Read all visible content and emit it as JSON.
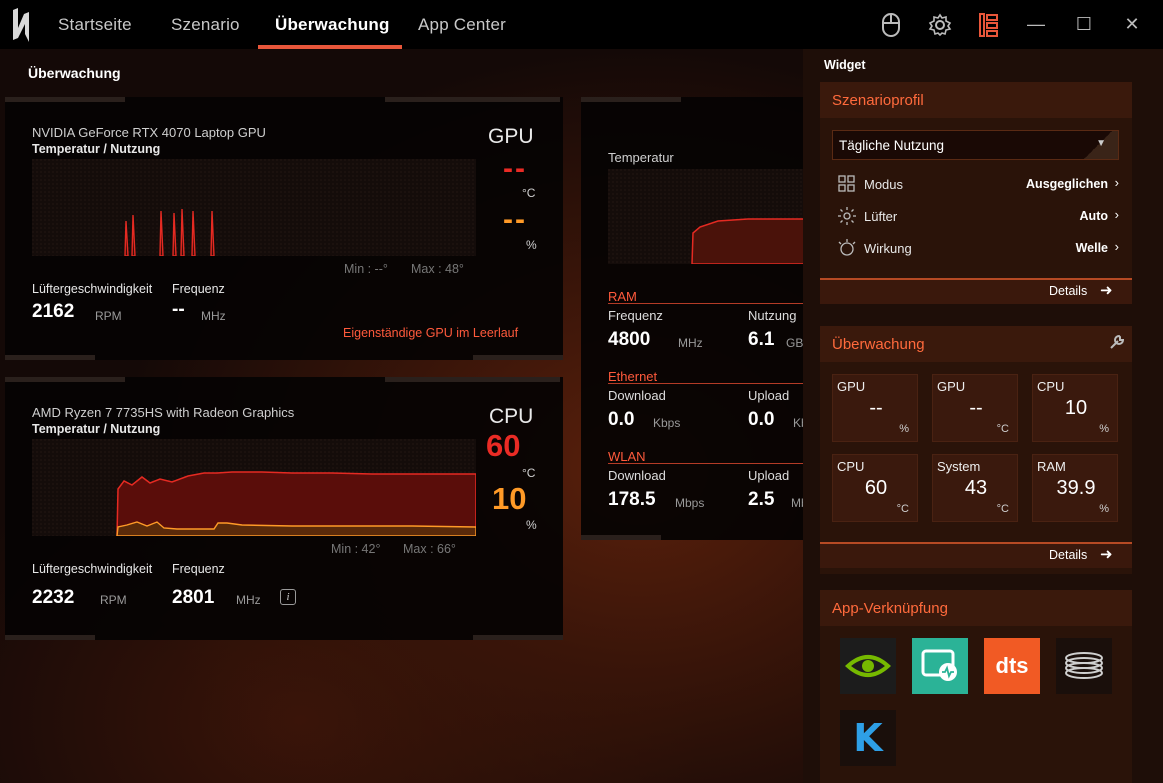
{
  "nav": {
    "tabs": [
      {
        "label": "Startseite"
      },
      {
        "label": "Szenario"
      },
      {
        "label": "Überwachung"
      },
      {
        "label": "App Center"
      }
    ]
  },
  "page_title": "Überwachung",
  "gpu": {
    "name": "NVIDIA GeForce RTX 4070 Laptop GPU",
    "subtitle": "Temperatur / Nutzung",
    "tag": "GPU",
    "temp": "--",
    "temp_unit": "°C",
    "usage": "--",
    "usage_unit": "%",
    "min": "Min : --°",
    "max": "Max : 48°",
    "fan_label": "Lüftergeschwindigkeit",
    "freq_label": "Frequenz",
    "fan_value": "2162",
    "fan_unit": "RPM",
    "freq_value": "--",
    "freq_unit": "MHz",
    "status": "Eigenständige GPU im Leerlauf"
  },
  "cpu": {
    "name": "AMD Ryzen 7 7735HS with Radeon Graphics",
    "subtitle": "Temperatur / Nutzung",
    "tag": "CPU",
    "temp": "60",
    "temp_unit": "°C",
    "usage": "10",
    "usage_unit": "%",
    "min": "Min : 42°",
    "max": "Max : 66°",
    "fan_label": "Lüftergeschwindigkeit",
    "freq_label": "Frequenz",
    "fan_value": "2232",
    "fan_unit": "RPM",
    "freq_value": "2801",
    "freq_unit": "MHz"
  },
  "system": {
    "temp_label": "Temperatur",
    "ram": {
      "title": "RAM",
      "freq_label": "Frequenz",
      "usage_label": "Nutzung",
      "freq_value": "4800",
      "freq_unit": "MHz",
      "usage_value": "6.1",
      "usage_unit": "GB"
    },
    "ethernet": {
      "title": "Ethernet",
      "down_label": "Download",
      "up_label": "Upload",
      "down_value": "0.0",
      "down_unit": "Kbps",
      "up_value": "0.0",
      "up_unit": "Kbps"
    },
    "wlan": {
      "title": "WLAN",
      "down_label": "Download",
      "up_label": "Upload",
      "down_value": "178.5",
      "down_unit": "Mbps",
      "up_value": "2.5",
      "up_unit": "Mbps"
    }
  },
  "widget": {
    "title": "Widget",
    "profile": {
      "title": "Szenarioprofil",
      "selected": "Tägliche Nutzung",
      "rows": [
        {
          "label": "Modus",
          "value": "Ausgeglichen"
        },
        {
          "label": "Lüfter",
          "value": "Auto"
        },
        {
          "label": "Wirkung",
          "value": "Welle"
        }
      ],
      "details": "Details"
    },
    "monitor": {
      "title": "Überwachung",
      "cells": [
        {
          "name": "GPU",
          "value": "--",
          "unit": "%"
        },
        {
          "name": "GPU",
          "value": "--",
          "unit": "°C"
        },
        {
          "name": "CPU",
          "value": "10",
          "unit": "%"
        },
        {
          "name": "CPU",
          "value": "60",
          "unit": "°C"
        },
        {
          "name": "System",
          "value": "43",
          "unit": "°C"
        },
        {
          "name": "RAM",
          "value": "39.9",
          "unit": "%"
        }
      ],
      "details": "Details"
    },
    "apps": {
      "title": "App-Verknüpfung",
      "items": [
        {
          "name": "nvidia-app-icon"
        },
        {
          "name": "monitor-app-icon"
        },
        {
          "name": "dts-app-icon",
          "text": "dts"
        },
        {
          "name": "coil-app-icon"
        },
        {
          "name": "k-app-icon",
          "text": "K"
        }
      ]
    }
  },
  "colors": {
    "accent": "#e8563a",
    "red": "#ea2b25",
    "orange": "#ff9a27"
  }
}
